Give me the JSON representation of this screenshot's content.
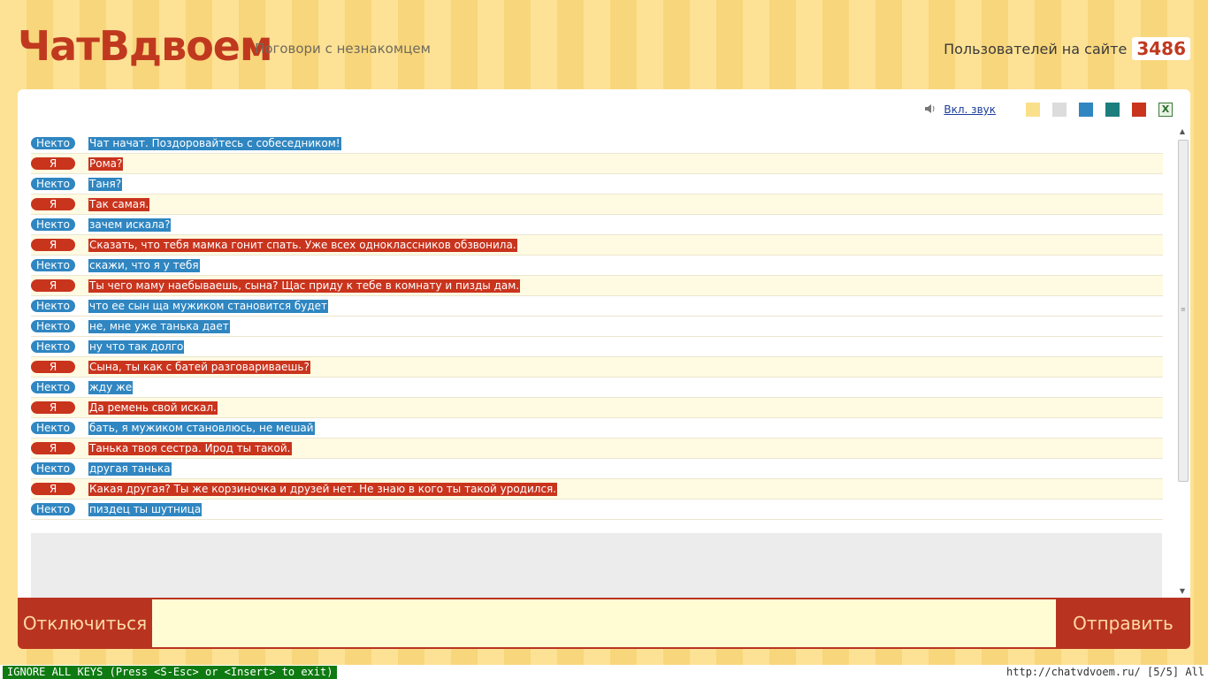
{
  "header": {
    "logo": "ЧатВдвоем",
    "tagline": "Поговори с незнакомцем",
    "users_label": "Пользователей на сайте",
    "users_count": "3486"
  },
  "toolbar": {
    "sound_label": "Вкл. звук",
    "themes": [
      {
        "name": "yellow",
        "color": "#fbe08b"
      },
      {
        "name": "grey",
        "color": "#dcdcdc"
      },
      {
        "name": "blue",
        "color": "#2f86c1"
      },
      {
        "name": "teal",
        "color": "#1c7f7d"
      },
      {
        "name": "red",
        "color": "#c9341d"
      }
    ],
    "excel_icon": "X"
  },
  "chat": {
    "messages": [
      {
        "who": "someone",
        "label": "Некто",
        "text": "Чат начат. Поздоровайтесь с собеседником!"
      },
      {
        "who": "me",
        "label": "Я",
        "text": "Рома?"
      },
      {
        "who": "someone",
        "label": "Некто",
        "text": "Таня?"
      },
      {
        "who": "me",
        "label": "Я",
        "text": "Так самая."
      },
      {
        "who": "someone",
        "label": "Некто",
        "text": "зачем искала?"
      },
      {
        "who": "me",
        "label": "Я",
        "text": "Сказать, что тебя мамка гонит спать. Уже всех одноклассников обзвонила."
      },
      {
        "who": "someone",
        "label": "Некто",
        "text": "скажи, что я у тебя"
      },
      {
        "who": "me",
        "label": "Я",
        "text": "Ты чего маму наебываешь, сына? Щас приду к тебе в комнату и пизды дам."
      },
      {
        "who": "someone",
        "label": "Некто",
        "text": "что ее сын ща мужиком становится будет"
      },
      {
        "who": "someone",
        "label": "Некто",
        "text": "не, мне уже танька дает"
      },
      {
        "who": "someone",
        "label": "Некто",
        "text": "ну что так долго"
      },
      {
        "who": "me",
        "label": "Я",
        "text": "Сына, ты как с батей разговариваешь?"
      },
      {
        "who": "someone",
        "label": "Некто",
        "text": "жду же"
      },
      {
        "who": "me",
        "label": "Я",
        "text": "Да ремень свой искал."
      },
      {
        "who": "someone",
        "label": "Некто",
        "text": "бать, я мужиком становлюсь, не мешай"
      },
      {
        "who": "me",
        "label": "Я",
        "text": "Танька твоя сестра. Ирод ты такой."
      },
      {
        "who": "someone",
        "label": "Некто",
        "text": "другая танька"
      },
      {
        "who": "me",
        "label": "Я",
        "text": "Какая другая? Ты же корзиночка и друзей нет. Не знаю в кого ты такой уродился."
      },
      {
        "who": "someone",
        "label": "Некто",
        "text": "пиздец ты шутница"
      }
    ]
  },
  "bottom": {
    "disconnect_label": "Отключиться",
    "send_label": "Отправить",
    "input_value": ""
  },
  "statusline": {
    "mode": "IGNORE ALL KEYS (Press <S-Esc> or <Insert> to exit)",
    "url_info": "http://chatvdvoem.ru/ [5/5] All"
  }
}
